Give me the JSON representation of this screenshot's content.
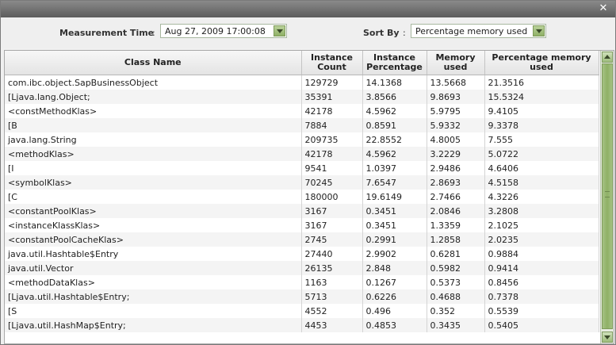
{
  "dialog": {
    "close_symbol": "✕"
  },
  "filters": {
    "measurement_label": "Measurement Time",
    "measurement_colon": ":",
    "measurement_value": "Aug 27, 2009 17:00:08",
    "sortby_label": "Sort By",
    "sortby_colon": ":",
    "sortby_value": "Percentage memory used"
  },
  "table": {
    "headers": [
      "Class Name",
      "Instance Count",
      "Instance Percentage",
      "Memory used",
      "Percentage memory used"
    ],
    "rows": [
      [
        "com.ibc.object.SapBusinessObject",
        "129729",
        "14.1368",
        "13.5668",
        "21.3516"
      ],
      [
        "[Ljava.lang.Object;",
        "35391",
        "3.8566",
        "9.8693",
        "15.5324"
      ],
      [
        "<constMethodKlas>",
        "42178",
        "4.5962",
        "5.9795",
        "9.4105"
      ],
      [
        "[B",
        "7884",
        "0.8591",
        "5.9332",
        "9.3378"
      ],
      [
        "java.lang.String",
        "209735",
        "22.8552",
        "4.8005",
        "7.555"
      ],
      [
        "<methodKlas>",
        "42178",
        "4.5962",
        "3.2229",
        "5.0722"
      ],
      [
        "[I",
        "9541",
        "1.0397",
        "2.9486",
        "4.6406"
      ],
      [
        "<symbolKlas>",
        "70245",
        "7.6547",
        "2.8693",
        "4.5158"
      ],
      [
        "[C",
        "180000",
        "19.6149",
        "2.7466",
        "4.3226"
      ],
      [
        "<constantPoolKlas>",
        "3167",
        "0.3451",
        "2.0846",
        "3.2808"
      ],
      [
        "<instanceKlassKlas>",
        "3167",
        "0.3451",
        "1.3359",
        "2.1025"
      ],
      [
        "<constantPoolCacheKlas>",
        "2745",
        "0.2991",
        "1.2858",
        "2.0235"
      ],
      [
        "java.util.Hashtable$Entry",
        "27440",
        "2.9902",
        "0.6281",
        "0.9884"
      ],
      [
        "java.util.Vector",
        "26135",
        "2.848",
        "0.5982",
        "0.9414"
      ],
      [
        "<methodDataKlas>",
        "1163",
        "0.1267",
        "0.5373",
        "0.8456"
      ],
      [
        "[Ljava.util.Hashtable$Entry;",
        "5713",
        "0.6226",
        "0.4688",
        "0.7378"
      ],
      [
        "[S",
        "4552",
        "0.496",
        "0.352",
        "0.5539"
      ],
      [
        "[Ljava.util.HashMap$Entry;",
        "4453",
        "0.4853",
        "0.3435",
        "0.5405"
      ]
    ]
  },
  "colors": {
    "titlebar": "#6e6e6e",
    "accent_green": "#8fb066",
    "row_alt": "#f4f4f4"
  }
}
